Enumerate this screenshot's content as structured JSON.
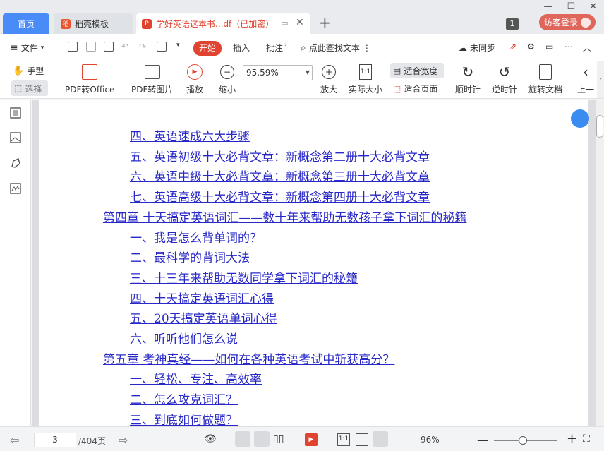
{
  "tabs": [
    {
      "label": "首页"
    },
    {
      "label": "稻壳模板"
    },
    {
      "label": "学好英语这本书...df（已加密）"
    }
  ],
  "window": {
    "count_badge": "1",
    "login_label": "访客登录"
  },
  "menu": {
    "file": "文件",
    "start": "开始",
    "insert": "插入",
    "annotate": "批注",
    "search_placeholder": "点此查找文本",
    "sync": "未同步"
  },
  "ribbon": {
    "hand": "手型",
    "select": "选择",
    "pdf_to_office": "PDF转Office",
    "pdf_to_image": "PDF转图片",
    "play": "播放",
    "zoom_out": "缩小",
    "zoom_value": "95.59%",
    "zoom_in": "放大",
    "actual_size": "实际大小",
    "fit_width": "适合宽度",
    "fit_page": "适合页面",
    "rotate_cw": "顺时针",
    "rotate_ccw": "逆时针",
    "rotate_doc": "旋转文档",
    "prev": "上一"
  },
  "toc": [
    {
      "text": "四、英语速成六大步骤",
      "level": 2
    },
    {
      "text": "五、英语初级十大必背文章：新概念第二册十大必背文章",
      "level": 2
    },
    {
      "text": "六、英语中级十大必背文章：新概念第三册十大必背文章",
      "level": 2
    },
    {
      "text": "七、英语高级十大必背文章：新概念第四册十大必背文章",
      "level": 2
    },
    {
      "text": "第四章 十天搞定英语词汇——数十年来帮助无数孩子拿下词汇的秘籍",
      "level": 1
    },
    {
      "text": "一、我是怎么背单词的？",
      "level": 2
    },
    {
      "text": "二、最科学的背词大法",
      "level": 2
    },
    {
      "text": "三、十三年来帮助无数同学拿下词汇的秘籍",
      "level": 2
    },
    {
      "text": "四、十天搞定英语词汇心得",
      "level": 2
    },
    {
      "text": "五、20天搞定英语单词心得",
      "level": 2
    },
    {
      "text": "六、听听他们怎么说",
      "level": 2
    },
    {
      "text": "第五章 考神真经——如何在各种英语考试中斩获高分？",
      "level": 1
    },
    {
      "text": "一、轻松、专注、高效率",
      "level": 2
    },
    {
      "text": "二、怎么攻克词汇？",
      "level": 2
    },
    {
      "text": "三、到底如何做题？",
      "level": 2
    }
  ],
  "status": {
    "current_page": "3",
    "total_pages": "/404页",
    "zoom_percent": "96%",
    "zoom_level": 0.45
  },
  "colors": {
    "accent": "#4a8cf7",
    "start": "#e0432f",
    "link": "#2828c8"
  }
}
